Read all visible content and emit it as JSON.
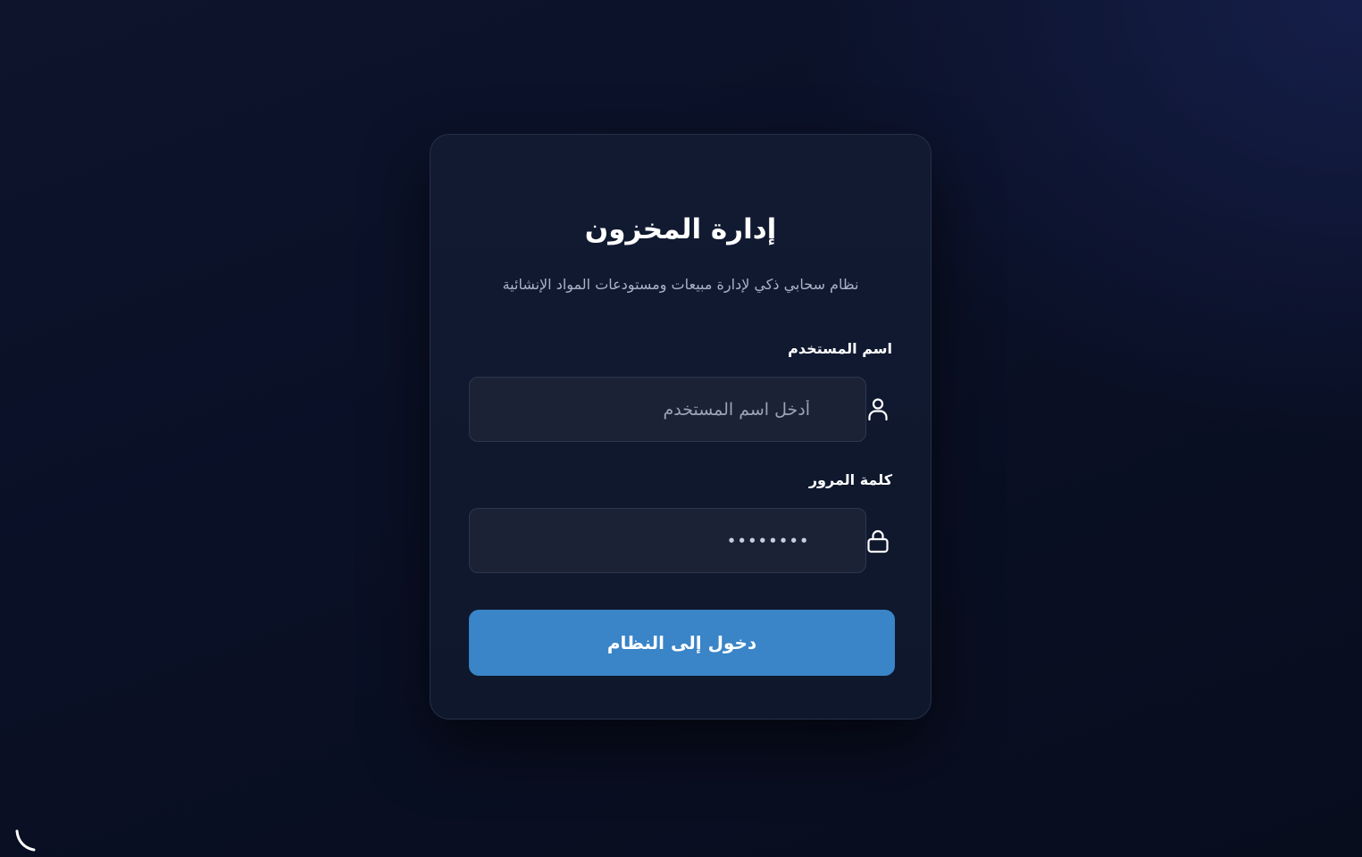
{
  "login": {
    "title": "إدارة المخزون",
    "subtitle": "نظام سحابي ذكي لإدارة مبيعات ومستودعات المواد الإنشائية",
    "username": {
      "label": "اسم المستخدم",
      "placeholder": "أدخل اسم المستخدم",
      "value": "",
      "icon": "user-icon"
    },
    "password": {
      "label": "كلمة المرور",
      "value": "••••••••",
      "icon": "lock-icon"
    },
    "submit_label": "دخول إلى النظام"
  },
  "corner": {
    "icon": "phone-icon"
  },
  "colors": {
    "accent": "#3a84c8",
    "card": "#111a31",
    "input": "#1b2236",
    "text_muted": "#a9b2c6"
  }
}
